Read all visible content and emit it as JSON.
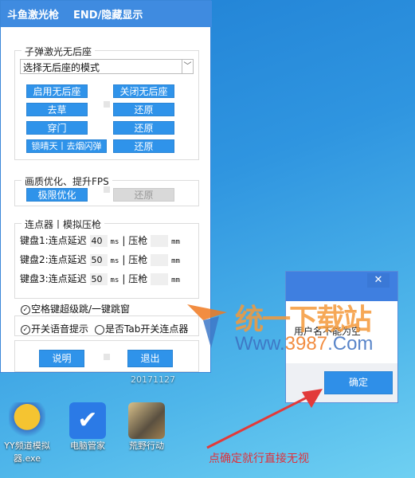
{
  "window": {
    "title": "斗鱼激光枪",
    "hotkey": "END/隐藏显示"
  },
  "recoil": {
    "legend": "子弹激光无后座",
    "combo_value": "选择无后座的模式",
    "buttons": [
      [
        "启用无后座",
        "关闭无后座"
      ],
      [
        "去草",
        "还原"
      ],
      [
        "穿门",
        "还原"
      ],
      [
        "锁晴天丨去烟闪弹",
        "还原"
      ]
    ]
  },
  "fps": {
    "legend": "画质优化、提升FPS",
    "optimize": "极限优化",
    "restore": "还原"
  },
  "clicker": {
    "legend": "连点器丨模拟压枪",
    "rows": [
      {
        "key": "键盘1:",
        "delay_label": "连点延迟",
        "delay": "40",
        "ms": "ms",
        "sep": "|",
        "press_label": "压枪",
        "press": "",
        "mm": "mm"
      },
      {
        "key": "键盘2:",
        "delay_label": "连点延迟",
        "delay": "50",
        "ms": "ms",
        "sep": "|",
        "press_label": "压枪",
        "press": "",
        "mm": "mm"
      },
      {
        "key": "键盘3:",
        "delay_label": "连点延迟",
        "delay": "50",
        "ms": "ms",
        "sep": "|",
        "press_label": "压枪",
        "press": "",
        "mm": "mm"
      }
    ]
  },
  "options": {
    "space_jump": "空格键超级跳/一键跳窗",
    "voice": "开关语音提示",
    "tab": "是否Tab开关连点器"
  },
  "footer": {
    "help": "说明",
    "exit": "退出"
  },
  "dialog": {
    "close": "✕",
    "message": "用户名不能为空",
    "ok": "确定"
  },
  "desktop": {
    "icons": [
      {
        "label": "YY频道模拟器.exe"
      },
      {
        "label": "电脑管家"
      },
      {
        "label": "荒野行动"
      }
    ],
    "partial_label": "20171127"
  },
  "annotation": "点确定就行直接无视",
  "watermark": {
    "cn": "统一下载站",
    "url_a": "Www.",
    "url_b": "3987",
    "url_c": ".Com"
  },
  "colors": {
    "accent": "#2f93ea",
    "annotation": "#e0303a"
  }
}
